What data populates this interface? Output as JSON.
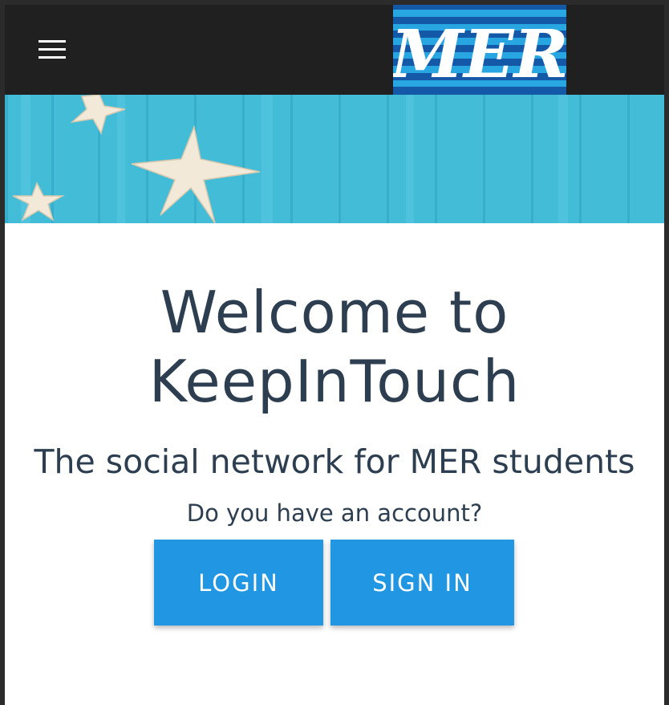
{
  "header": {
    "menu_icon": "hamburger-menu-icon",
    "logo_text": "MER"
  },
  "hero": {
    "title_line1": "Welcome to",
    "title_line2": "KeepInTouch",
    "subtitle": "The social network for MER students",
    "question": "Do you have an account?"
  },
  "actions": {
    "login_label": "LOGIN",
    "signin_label": "SIGN IN"
  },
  "colors": {
    "navbar": "#202020",
    "accent_button": "#2196e3",
    "text": "#2c3e50",
    "banner": "#3fb8d6",
    "logo_bg": "#1458a8"
  }
}
